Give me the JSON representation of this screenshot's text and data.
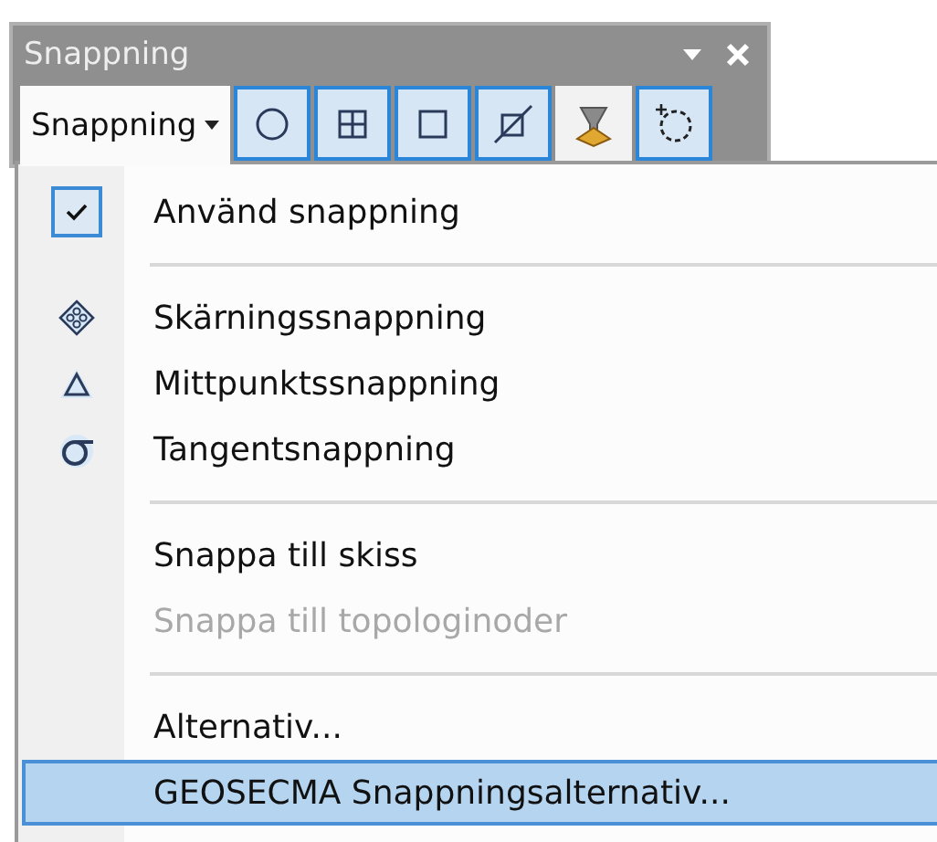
{
  "panel": {
    "title": "Snappning"
  },
  "toolbar": {
    "dropdown": {
      "label": "Snappning",
      "expanded": true
    },
    "buttons": [
      {
        "kind": "point",
        "selected": true
      },
      {
        "kind": "end",
        "selected": true
      },
      {
        "kind": "vertex",
        "selected": true
      },
      {
        "kind": "edge",
        "selected": true
      },
      {
        "kind": "funnel",
        "selected": false
      },
      {
        "kind": "tolerance",
        "selected": true
      }
    ]
  },
  "menu": [
    {
      "kind": "check",
      "label": "Använd snappning",
      "checked": true,
      "disabled": false,
      "selected": false
    },
    {
      "kind": "separator"
    },
    {
      "kind": "intersection",
      "label": "Skärningssnappning",
      "disabled": false,
      "selected": false
    },
    {
      "kind": "midpoint",
      "label": "Mittpunktssnappning",
      "disabled": false,
      "selected": false
    },
    {
      "kind": "tangent",
      "label": "Tangentsnappning",
      "disabled": false,
      "selected": false
    },
    {
      "kind": "separator"
    },
    {
      "kind": "plain",
      "label": "Snappa till skiss",
      "disabled": false,
      "selected": false
    },
    {
      "kind": "plain",
      "label": "Snappa till topologinoder",
      "disabled": true,
      "selected": false
    },
    {
      "kind": "separator"
    },
    {
      "kind": "plain",
      "label": "Alternativ...",
      "disabled": false,
      "selected": false
    },
    {
      "kind": "plain",
      "label": "GEOSECMA Snappningsalternativ...",
      "disabled": false,
      "selected": true
    }
  ]
}
